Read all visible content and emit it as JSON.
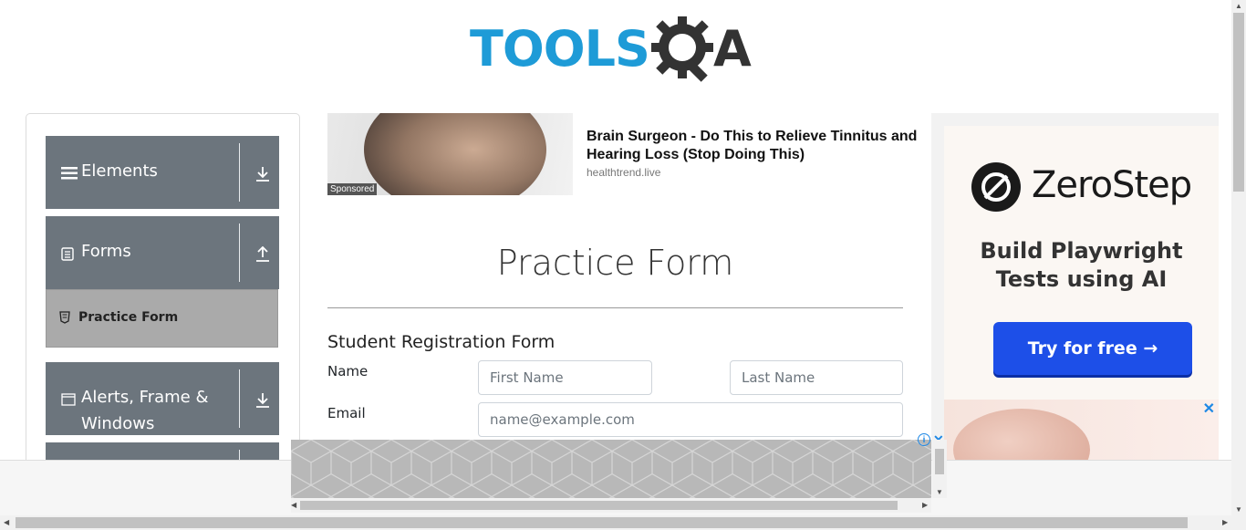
{
  "header": {
    "logo_left": "TOOLS",
    "logo_right": "A"
  },
  "sidebar": {
    "groups": [
      {
        "label": "Elements",
        "icon": "hamburger-icon",
        "arrow": "download-icon"
      },
      {
        "label": "Forms",
        "icon": "document-icon",
        "arrow": "upload-icon"
      },
      {
        "label": "Alerts, Frame &",
        "label2": "Windows",
        "icon": "window-icon",
        "arrow": "download-icon"
      }
    ],
    "active_item": {
      "label": "Practice Form",
      "icon": "html5-icon"
    }
  },
  "ad_top": {
    "sponsored": "Sponsored",
    "title": "Brain Surgeon - Do This to Relieve Tinnitus and Hearing Loss (Stop Doing This)",
    "domain": "healthtrend.live"
  },
  "main": {
    "title": "Practice Form",
    "form_title": "Student Registration Form",
    "name_label": "Name",
    "first_name_placeholder": "First Name",
    "last_name_placeholder": "Last Name",
    "email_label": "Email",
    "email_placeholder": "name@example.com"
  },
  "ad_right": {
    "brand": "ZeroStep",
    "tagline_line1": "Build Playwright",
    "tagline_line2": "Tests using AI",
    "cta": "Try for free →",
    "close": "✕"
  },
  "bottom_ad": {
    "info": "i",
    "close": "✕"
  },
  "colors": {
    "sidebar_bg": "#6c757d",
    "logo_blue": "#1e9bd7",
    "cta_blue": "#1d4fe8"
  }
}
